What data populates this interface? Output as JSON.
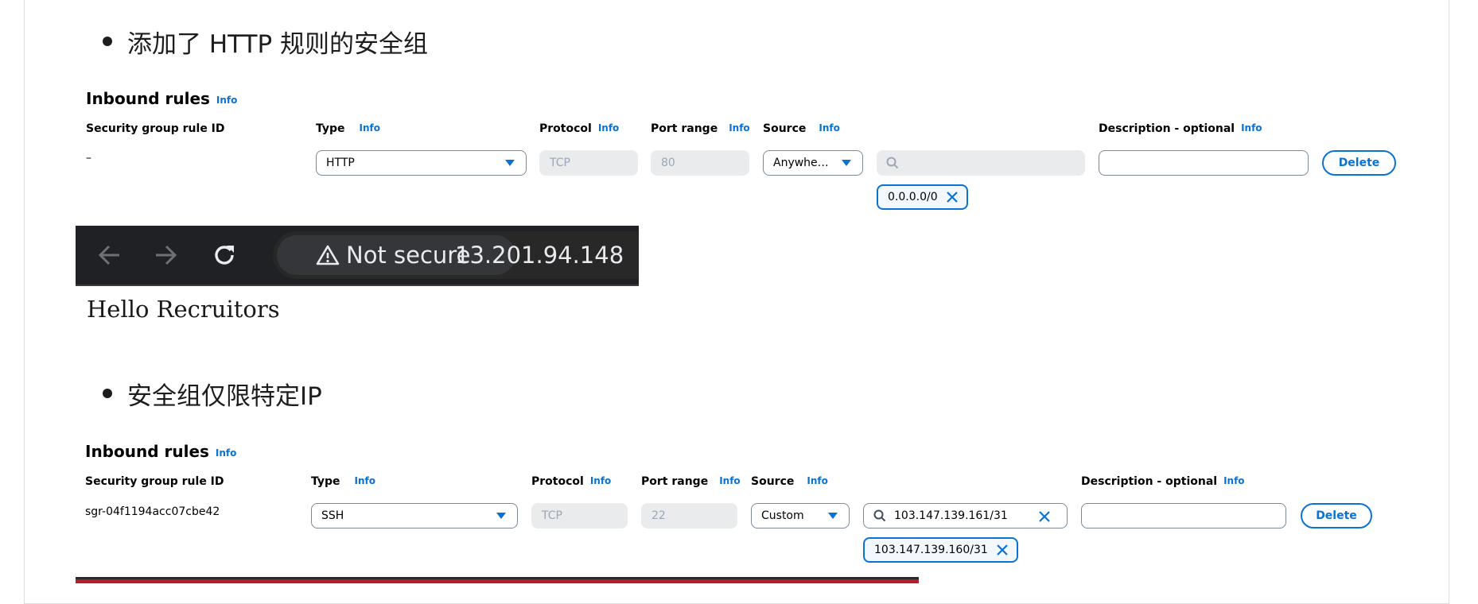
{
  "bullets": {
    "first": "添加了 HTTP 规则的安全组",
    "second": "安全组仅限特定IP"
  },
  "rules_1": {
    "title": "Inbound rules",
    "title_info": "Info",
    "headers": {
      "rule_id": "Security group rule ID",
      "type": "Type",
      "type_info": "Info",
      "protocol": "Protocol",
      "protocol_info": "Info",
      "port_range": "Port range",
      "port_range_info": "Info",
      "source": "Source",
      "source_info": "Info",
      "description": "Description - optional",
      "description_info": "Info"
    },
    "row": {
      "rule_id": "–",
      "type": "HTTP",
      "protocol": "TCP",
      "port_range": "80",
      "source": "Anywhe…",
      "search_value": "",
      "token": "0.0.0.0/0",
      "delete_label": "Delete"
    }
  },
  "browser": {
    "security_label": "Not secure",
    "url": "13.201.94.148",
    "page_text": "Hello Recruitors"
  },
  "rules_2": {
    "title": "Inbound rules",
    "title_info": "Info",
    "headers": {
      "rule_id": "Security group rule ID",
      "type": "Type",
      "type_info": "Info",
      "protocol": "Protocol",
      "protocol_info": "Info",
      "port_range": "Port range",
      "port_range_info": "Info",
      "source": "Source",
      "source_info": "Info",
      "description": "Description - optional",
      "description_info": "Info"
    },
    "row": {
      "rule_id": "sgr-04f1194acc07cbe42",
      "type": "SSH",
      "protocol": "TCP",
      "port_range": "22",
      "source": "Custom",
      "search_value": "103.147.139.161/31",
      "token": "103.147.139.160/31",
      "delete_label": "Delete"
    }
  },
  "icons": [
    "back-arrow-icon",
    "forward-arrow-icon",
    "reload-icon",
    "warning-icon",
    "search-icon",
    "close-icon",
    "caret-down-icon"
  ],
  "colors": {
    "accent": "#0972d3",
    "browser_bar": "#202124",
    "border": "#7d8998",
    "disabled_bg": "#e9ebed"
  }
}
